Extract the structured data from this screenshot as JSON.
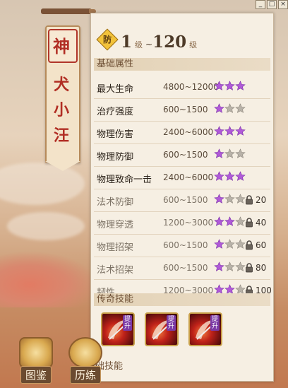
{
  "window": {
    "minimize_icon": "minimize-icon",
    "restore_icon": "restore-icon",
    "close_icon": "close-icon",
    "min_glyph": "_",
    "max_glyph": "□",
    "close_glyph": "×"
  },
  "banner": {
    "line1": "神",
    "line2": "犬",
    "line3": "小",
    "line4": "汪"
  },
  "rank": {
    "badge": "防",
    "min": "1",
    "min_unit": "级",
    "sep": "~",
    "max": "120",
    "max_unit": "级"
  },
  "sections": {
    "attributes": "基础属性",
    "skills": "传奇技能",
    "basic_skills_partial": "础技能"
  },
  "colors": {
    "star_active": "#b05ad8",
    "star_inactive": "#b8b2a8",
    "accent_red": "#b12e24"
  },
  "attributes": [
    {
      "name": "最大生命",
      "value": "4800~12000",
      "stars": 3,
      "locked": false,
      "unlock_level": ""
    },
    {
      "name": "治疗强度",
      "value": "600~1500",
      "stars": 1,
      "locked": false,
      "unlock_level": ""
    },
    {
      "name": "物理伤害",
      "value": "2400~6000",
      "stars": 3,
      "locked": false,
      "unlock_level": ""
    },
    {
      "name": "物理防御",
      "value": "600~1500",
      "stars": 1,
      "locked": false,
      "unlock_level": ""
    },
    {
      "name": "物理致命一击",
      "value": "2400~6000",
      "stars": 3,
      "locked": false,
      "unlock_level": ""
    },
    {
      "name": "法术防御",
      "value": "600~1500",
      "stars": 1,
      "locked": true,
      "unlock_level": "20"
    },
    {
      "name": "物理穿透",
      "value": "1200~3000",
      "stars": 2,
      "locked": true,
      "unlock_level": "40"
    },
    {
      "name": "物理招架",
      "value": "600~1500",
      "stars": 1,
      "locked": true,
      "unlock_level": "60"
    },
    {
      "name": "法术招架",
      "value": "600~1500",
      "stars": 1,
      "locked": true,
      "unlock_level": "80"
    },
    {
      "name": "韧性",
      "value": "1200~3000",
      "stars": 2,
      "locked": true,
      "unlock_level": "100"
    }
  ],
  "skills": [
    {
      "tag": "提升",
      "icon": "crescent-blade-icon"
    },
    {
      "tag": "提升",
      "icon": "spear-slash-icon"
    },
    {
      "tag": "提升",
      "icon": "crescent-blade-icon"
    }
  ],
  "bottom_buttons": [
    {
      "label": "图鉴",
      "icon": "codex-book-icon"
    },
    {
      "label": "历练",
      "icon": "training-egg-icon"
    }
  ]
}
